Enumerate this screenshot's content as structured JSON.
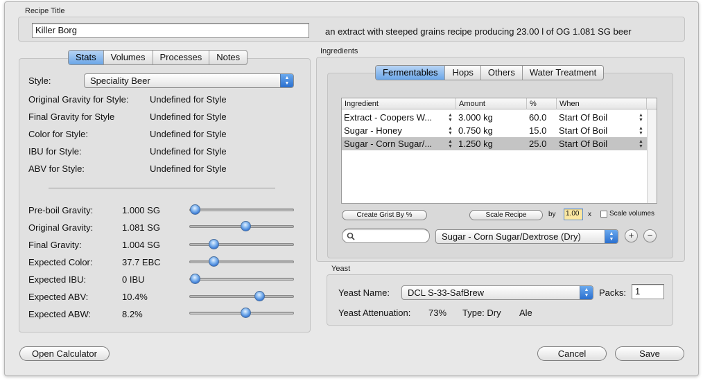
{
  "title_group": {
    "label": "Recipe Title",
    "name_value": "Killer Borg",
    "description": "an extract with steeped grains recipe producing 23.00 l of OG 1.081 SG beer"
  },
  "left_tabs": [
    {
      "label": "Stats"
    },
    {
      "label": "Volumes"
    },
    {
      "label": "Processes"
    },
    {
      "label": "Notes"
    }
  ],
  "style": {
    "label": "Style:",
    "value": "Speciality Beer"
  },
  "style_stats": [
    {
      "label": "Original Gravity for Style:",
      "value": "Undefined for Style"
    },
    {
      "label": "Final Gravity for Style",
      "value": "Undefined for Style"
    },
    {
      "label": "Color for Style:",
      "value": "Undefined for Style"
    },
    {
      "label": "IBU for Style:",
      "value": "Undefined for Style"
    },
    {
      "label": "ABV for Style:",
      "value": "Undefined for Style"
    }
  ],
  "sliders": [
    {
      "label": "Pre-boil Gravity:",
      "value": "1.000 SG",
      "level": 0.05
    },
    {
      "label": "Original Gravity:",
      "value": "1.081 SG",
      "level": 0.54
    },
    {
      "label": "Final Gravity:",
      "value": "1.004 SG",
      "level": 0.23
    },
    {
      "label": "Expected Color:",
      "value": "37.7 EBC",
      "level": 0.23
    },
    {
      "label": "Expected IBU:",
      "value": "0 IBU",
      "level": 0.05
    },
    {
      "label": "Expected ABV:",
      "value": "10.4%",
      "level": 0.67
    },
    {
      "label": "Expected ABW:",
      "value": "8.2%",
      "level": 0.54
    }
  ],
  "ingredients": {
    "label": "Ingredients",
    "tabs": [
      {
        "label": "Fermentables"
      },
      {
        "label": "Hops"
      },
      {
        "label": "Others"
      },
      {
        "label": "Water Treatment"
      }
    ],
    "columns": [
      "Ingredient",
      "Amount",
      "%",
      "When"
    ],
    "rows": [
      {
        "ingredient": "Extract - Coopers W...",
        "amount": "3.000 kg",
        "pct": "60.0",
        "when": "Start Of Boil"
      },
      {
        "ingredient": "Sugar - Honey",
        "amount": "0.750 kg",
        "pct": "15.0",
        "when": "Start Of Boil"
      },
      {
        "ingredient": "Sugar - Corn Sugar/...",
        "amount": "1.250 kg",
        "pct": "25.0",
        "when": "Start Of Boil"
      }
    ],
    "create_grist_label": "Create Grist By %",
    "scale_recipe_label": "Scale Recipe",
    "by_label": "by",
    "scale_value": "1.00",
    "x_label": "x",
    "scale_volumes_label": "Scale volumes",
    "search_placeholder": "",
    "selected_ingredient": "Sugar - Corn Sugar/Dextrose (Dry)",
    "add_symbol": "+",
    "remove_symbol": "−"
  },
  "yeast": {
    "label": "Yeast",
    "name_label": "Yeast Name:",
    "name_value": "DCL S-33-SafBrew",
    "packs_label": "Packs:",
    "packs_value": "1",
    "attenuation_label": "Yeast Attenuation:",
    "attenuation_value": "73%",
    "type_label": "Type: Dry",
    "kind": "Ale"
  },
  "buttons": {
    "open_calculator": "Open Calculator",
    "cancel": "Cancel",
    "save": "Save"
  },
  "icons": {
    "popup_arrows": "up-down-arrows-icon",
    "stepper": "stepper-icon",
    "search": "magnifier-icon"
  },
  "colors": {
    "accent": "#6aa6e8",
    "selection": "#c4c4c4",
    "window": "#e8e8e8",
    "scale_field": "#fbe7a1"
  }
}
